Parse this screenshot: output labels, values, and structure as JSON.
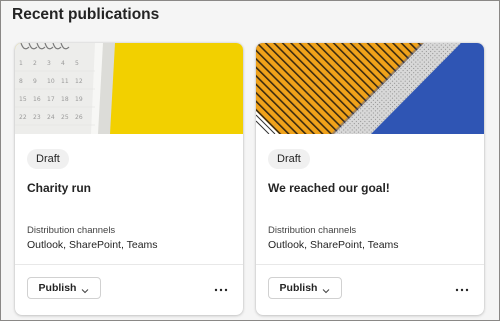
{
  "section": {
    "title": "Recent publications"
  },
  "cards": [
    {
      "status": "Draft",
      "title": "Charity run",
      "channels_label": "Distribution channels",
      "channels_value": "Outlook, SharePoint, Teams",
      "publish_label": "Publish",
      "image": "calendar-on-yellow",
      "more_icon": "more-horizontal-icon"
    },
    {
      "status": "Draft",
      "title": "We reached our goal!",
      "channels_label": "Distribution channels",
      "channels_value": "Outlook, SharePoint, Teams",
      "publish_label": "Publish",
      "image": "orange-building-facade",
      "more_icon": "more-horizontal-icon"
    }
  ],
  "colors": {
    "yellow": "#f2d000",
    "orange": "#f0a21a",
    "blue": "#2f55b4",
    "badge_bg": "#f0f0f0"
  }
}
